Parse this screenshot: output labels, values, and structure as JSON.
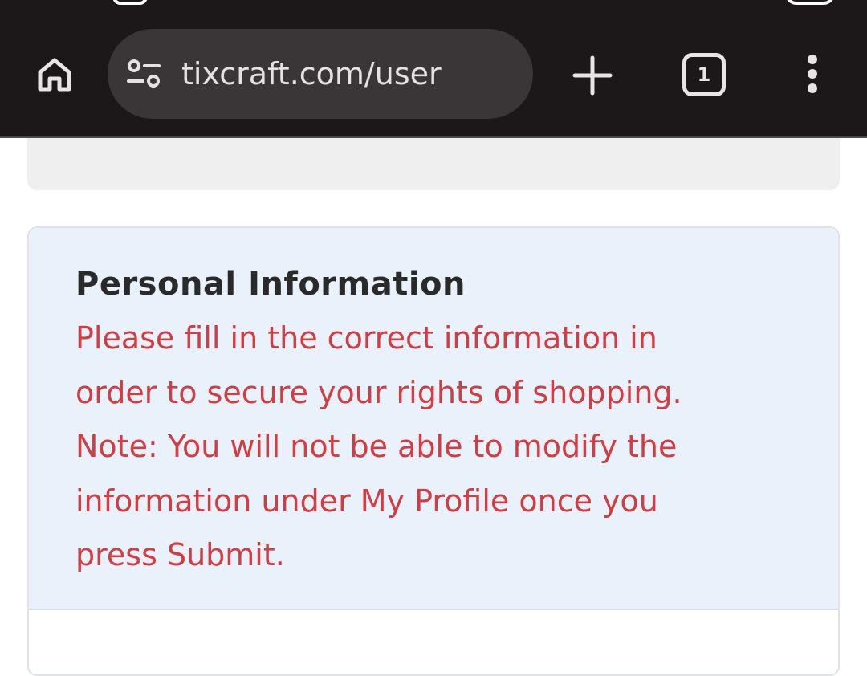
{
  "browser": {
    "url": "tixcraft.com/user",
    "tab_count": "1",
    "icons": {
      "home": "home-icon",
      "site_info": "tune-icon",
      "new_tab": "plus-icon",
      "tabs": "tab-switcher-icon",
      "menu": "more-vert-icon"
    }
  },
  "card": {
    "title": "Personal Information",
    "notice_lines": [
      "Please fill in the correct information in",
      "order to secure your rights of shopping.",
      "Note: You will not be able to modify the",
      "information under My Profile once you",
      "press Submit."
    ]
  },
  "colors": {
    "toolbar_bg": "#1c1719",
    "omnibox_bg": "#3a3638",
    "card_header_bg": "#e9f1fa",
    "notice_text": "#d23c43"
  }
}
